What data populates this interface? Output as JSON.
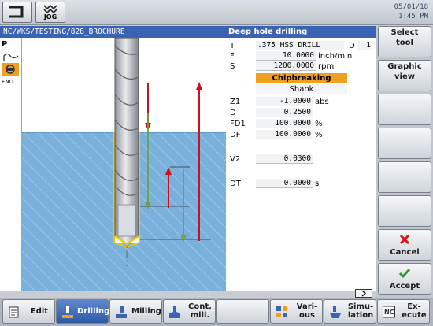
{
  "header": {
    "mode_label": "JOG",
    "date": "05/01/18",
    "time": "1:45 PM"
  },
  "title": {
    "program_path": "NC/WKS/TESTING/828_BROCHURE",
    "cycle_name": "Deep hole drilling"
  },
  "left_panel": {
    "p_label": "P",
    "end_label": "END"
  },
  "params": {
    "tool_label": "T",
    "tool_value": ".375 HSS DRILL",
    "d_label": "D",
    "d_value": "1",
    "f_label": "F",
    "f_value": "10.0000",
    "f_unit": "inch/min",
    "s_label": "S",
    "s_value": "1200.0000",
    "s_unit": "rpm",
    "mode_value": "Chipbreaking",
    "shank_value": "Shank",
    "z1_label": "Z1",
    "z1_value": "-1.0000",
    "z1_unit": "abs",
    "dd_label": "D",
    "dd_value": "0.2500",
    "fd1_label": "FD1",
    "fd1_value": "100.0000",
    "fd1_unit": "%",
    "df_label": "DF",
    "df_value": "100.0000",
    "df_unit": "%",
    "v2_label": "V2",
    "v2_value": "0.0300",
    "dt_label": "DT",
    "dt_value": "0.0000",
    "dt_unit": "s"
  },
  "softkeys_right": [
    {
      "line1": "Select",
      "line2": "tool"
    },
    {
      "line1": "Graphic",
      "line2": "view"
    },
    {
      "line1": "",
      "line2": ""
    },
    {
      "line1": "",
      "line2": ""
    },
    {
      "line1": "",
      "line2": ""
    },
    {
      "line1": "",
      "line2": ""
    },
    {
      "line1": "Cancel",
      "icon": "cancel-icon"
    },
    {
      "line1": "Accept",
      "icon": "accept-icon"
    }
  ],
  "softkeys_bottom": [
    {
      "line1": "Edit",
      "line2": ""
    },
    {
      "line1": "Drilling",
      "line2": ""
    },
    {
      "line1": "Milling",
      "line2": ""
    },
    {
      "line1": "Cont.",
      "line2": "mill."
    },
    {
      "line1": "",
      "line2": ""
    },
    {
      "line1": "Vari-",
      "line2": "ous"
    },
    {
      "line1": "Simu-",
      "line2": "lation"
    },
    {
      "line1": "Ex-",
      "line2": "ecute"
    }
  ],
  "colors": {
    "title_bar": "#3b63b4",
    "workpiece": "#7ab0dc",
    "highlight": "#f0a020",
    "arrow_red": "#cc1020",
    "arrow_green": "#70a040",
    "active_key": "#2f5aa6"
  }
}
